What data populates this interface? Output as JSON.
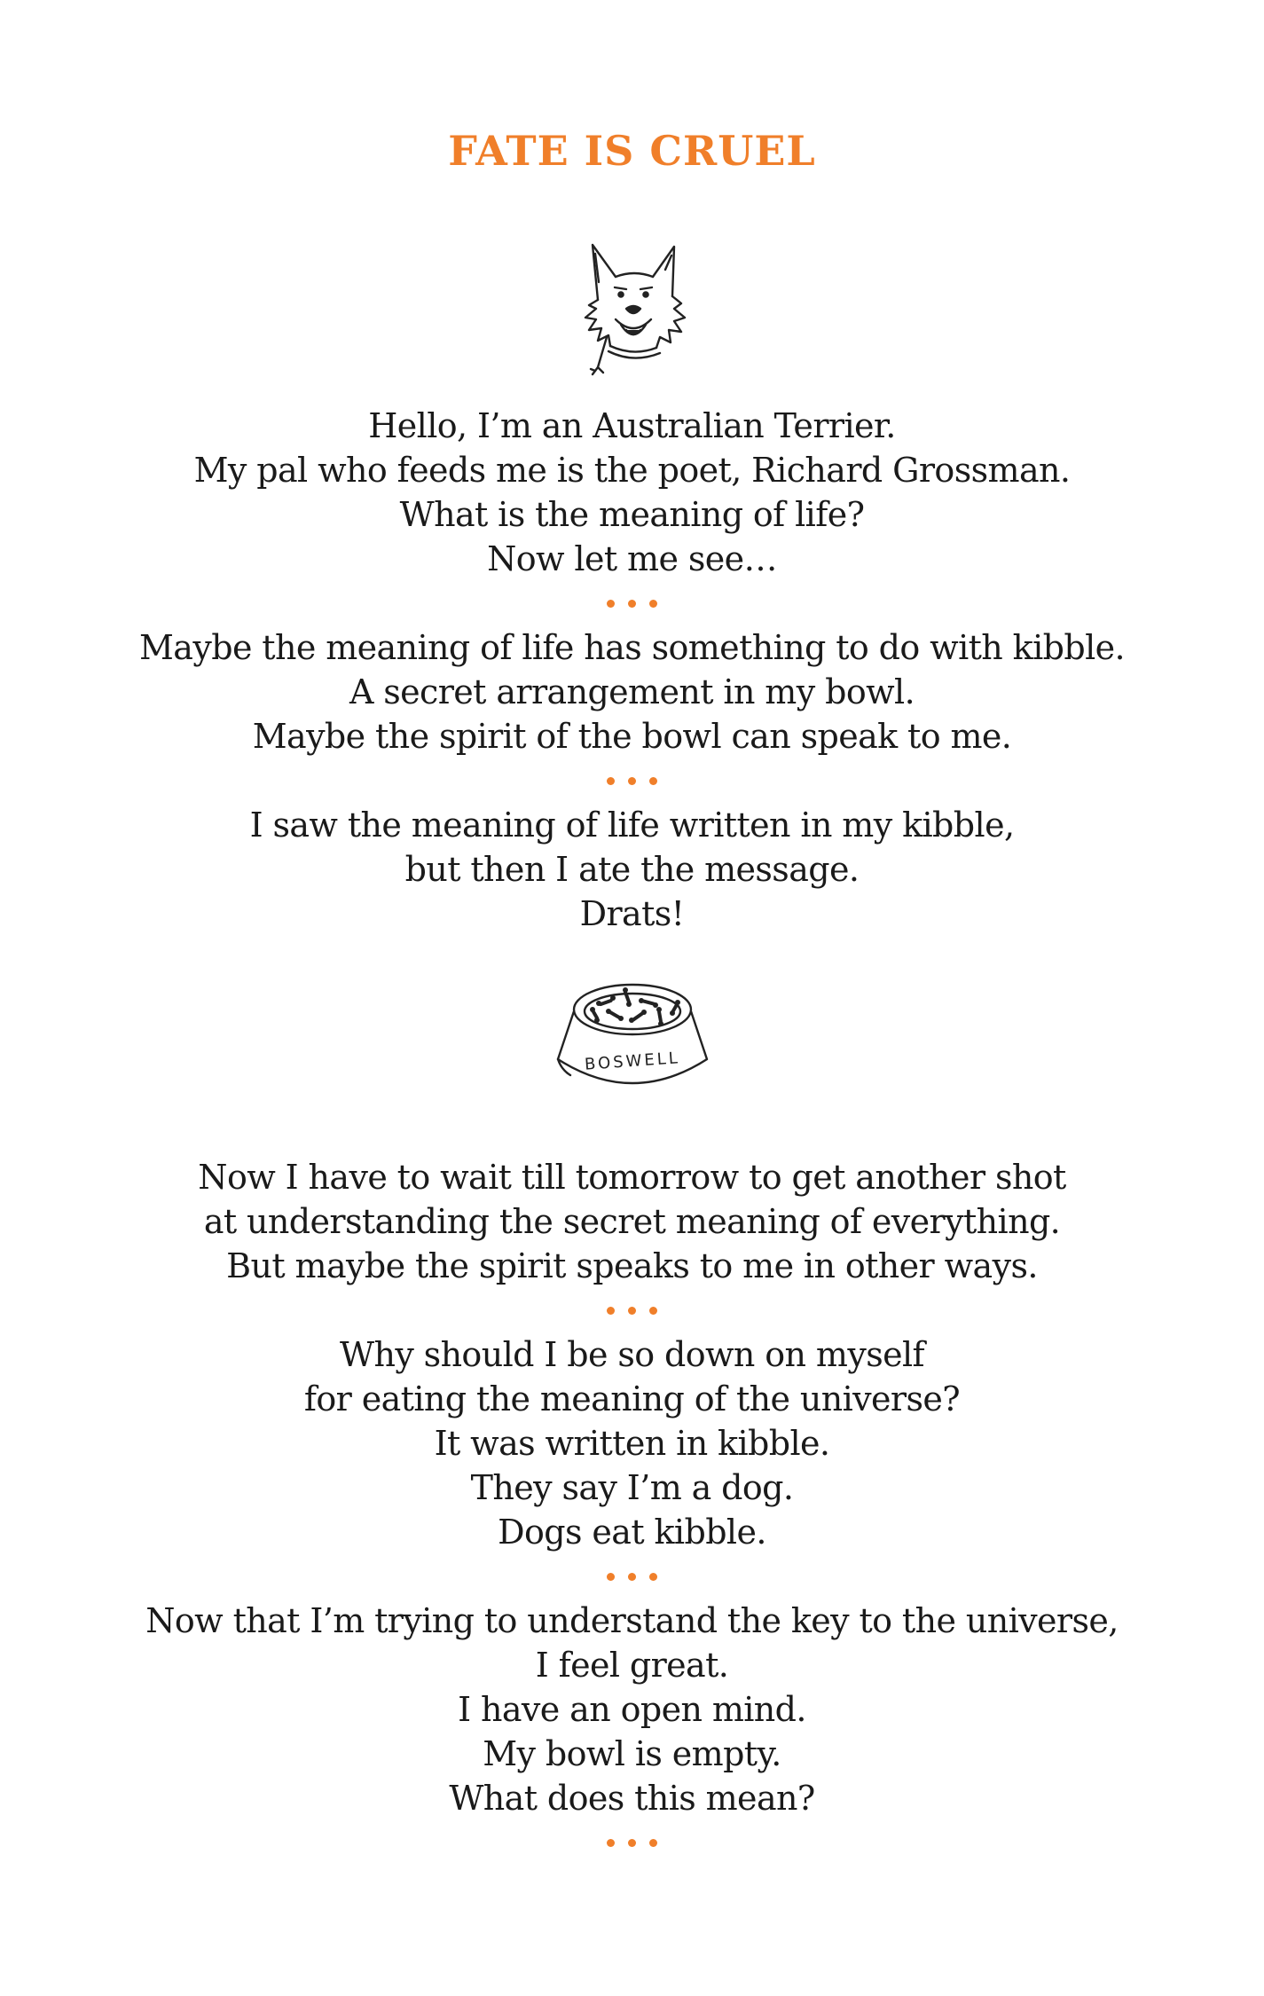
{
  "title": "FATE IS CRUEL",
  "illustrations": {
    "dog": "terrier-head-icon",
    "bowl_label": "BOSWELL"
  },
  "colors": {
    "accent": "#f07f2a",
    "text": "#1a1a1a"
  },
  "stanzas": [
    {
      "lines": [
        "Hello, I’m an Australian Terrier.",
        "My pal who feeds me is the poet, Richard Grossman.",
        "What is the meaning of life?",
        "Now let me see…"
      ]
    },
    {
      "lines": [
        "Maybe the meaning of life has something to do with kibble.",
        "A secret arrangement in my bowl.",
        "Maybe the spirit of the bowl can speak to me."
      ]
    },
    {
      "lines": [
        "I saw the meaning of life written in my kibble,",
        "but then I ate the message.",
        "Drats!"
      ]
    },
    {
      "lines": [
        "Now I have to wait till tomorrow to get another shot",
        "at understanding the secret meaning of everything.",
        "But maybe the spirit speaks to me in other ways."
      ]
    },
    {
      "lines": [
        "Why should I be so down on myself",
        "for eating the meaning of the universe?",
        "It was written in kibble.",
        "They say I’m a dog.",
        "Dogs eat kibble."
      ]
    },
    {
      "lines": [
        "Now that I’m trying to understand the key to the universe,",
        "I feel great.",
        "I have an open mind.",
        "My bowl is empty.",
        "What does this mean?"
      ]
    }
  ]
}
